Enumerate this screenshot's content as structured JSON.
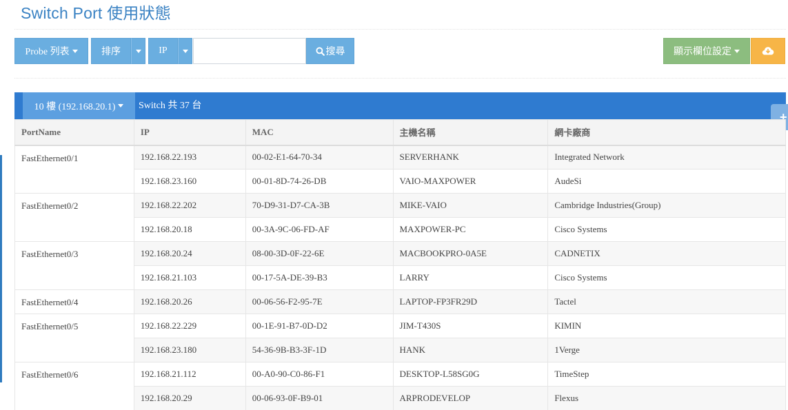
{
  "page": {
    "title": "Switch Port 使用狀態"
  },
  "toolbar": {
    "probe_label": "Probe 列表",
    "sort_label": "排序",
    "ip_label": "IP",
    "search_value": "",
    "search_label": "搜尋",
    "columns_label": "顯示欄位設定"
  },
  "panel": {
    "floor_label": "10 樓 (192.168.20.1)",
    "switch_count": "Switch 共 37 台"
  },
  "table": {
    "headers": [
      "PortName",
      "IP",
      "MAC",
      "主機名稱",
      "網卡廠商"
    ],
    "groups": [
      {
        "port": "FastEthernet0/1",
        "rows": [
          {
            "ip": "192.168.22.193",
            "mac": "00-02-E1-64-70-34",
            "host": "SERVERHANK",
            "vendor": "Integrated Network"
          },
          {
            "ip": "192.168.23.160",
            "mac": "00-01-8D-74-26-DB",
            "host": "VAIO-MAXPOWER",
            "vendor": "AudeSi"
          }
        ]
      },
      {
        "port": "FastEthernet0/2",
        "rows": [
          {
            "ip": "192.168.22.202",
            "mac": "70-D9-31-D7-CA-3B",
            "host": "MIKE-VAIO",
            "vendor": "Cambridge Industries(Group)"
          },
          {
            "ip": "192.168.20.18",
            "mac": "00-3A-9C-06-FD-AF",
            "host": "MAXPOWER-PC",
            "vendor": "Cisco Systems"
          }
        ]
      },
      {
        "port": "FastEthernet0/3",
        "rows": [
          {
            "ip": "192.168.20.24",
            "mac": "08-00-3D-0F-22-6E",
            "host": "MACBOOKPRO-0A5E",
            "vendor": "CADNETIX"
          },
          {
            "ip": "192.168.21.103",
            "mac": "00-17-5A-DE-39-B3",
            "host": "LARRY",
            "vendor": "Cisco Systems"
          }
        ]
      },
      {
        "port": "FastEthernet0/4",
        "rows": [
          {
            "ip": "192.168.20.26",
            "mac": "00-06-56-F2-95-7E",
            "host": "LAPTOP-FP3FR29D",
            "vendor": "Tactel"
          }
        ]
      },
      {
        "port": "FastEthernet0/5",
        "rows": [
          {
            "ip": "192.168.22.229",
            "mac": "00-1E-91-B7-0D-D2",
            "host": "JIM-T430S",
            "vendor": "KIMIN"
          },
          {
            "ip": "192.168.23.180",
            "mac": "54-36-9B-B3-3F-1D",
            "host": "HANK",
            "vendor": "1Verge"
          }
        ]
      },
      {
        "port": "FastEthernet0/6",
        "rows": [
          {
            "ip": "192.168.21.112",
            "mac": "00-A0-90-C0-86-F1",
            "host": "DESKTOP-L58SG0G",
            "vendor": "TimeStep"
          },
          {
            "ip": "192.168.20.29",
            "mac": "00-06-93-0F-B9-01",
            "host": "ARPRODEVELOP",
            "vendor": "Flexus"
          }
        ]
      }
    ]
  },
  "colors": {
    "primary": "#2f7bd0",
    "title": "#3a82c3",
    "button": "#6aaee0",
    "green": "#8cbd7f",
    "orange": "#f7b547"
  },
  "icons": [
    "search-icon",
    "caret-down-icon",
    "cloud-download-icon",
    "plus-icon"
  ]
}
